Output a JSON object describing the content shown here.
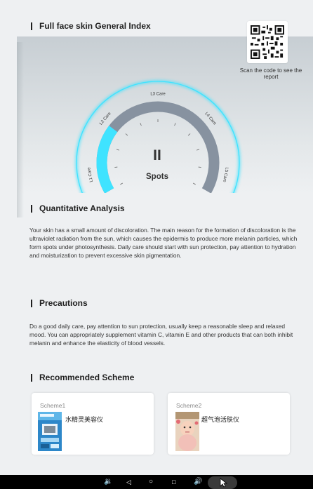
{
  "header": {
    "title": "Full face skin General Index"
  },
  "qr": {
    "caption": "Scan the code to see the report",
    "icon": "qr-code-icon"
  },
  "gauge": {
    "center_label": "Spots",
    "level_symbol": "II",
    "ring_labels": [
      "L1 Care",
      "L2 Care",
      "L3 Care",
      "L4 Care",
      "L5 Care"
    ],
    "active_fraction": 0.28,
    "accent_color": "#3fe3ff",
    "track_color": "#8792a0"
  },
  "analysis": {
    "title": "Quantitative Analysis",
    "text": "Your skin has a small amount of discoloration. The main reason for the formation of discoloration is the ultraviolet radiation from the sun, which causes the epidermis to produce more melanin particles, which form spots under photosynthesis. Daily care should start with sun protection, pay attention to hydration and moisturization to prevent excessive skin pigmentation."
  },
  "precautions": {
    "title": "Precautions",
    "text": "Do a good daily care, pay attention to sun protection, usually keep a reasonable sleep and relaxed mood. You can appropriately supplement vitamin C, vitamin E and other products that can both inhibit melanin and enhance the elasticity of blood vessels."
  },
  "recommended": {
    "title": "Recommended Scheme",
    "schemes": [
      {
        "label": "Scheme1",
        "name": "水精灵美容仪"
      },
      {
        "label": "Scheme2",
        "name": "超气泡活肤仪"
      }
    ]
  },
  "navbar": {
    "icons": [
      "volume-down-icon",
      "back-icon",
      "home-icon",
      "recents-icon",
      "volume-up-icon",
      "cursor-icon"
    ]
  }
}
